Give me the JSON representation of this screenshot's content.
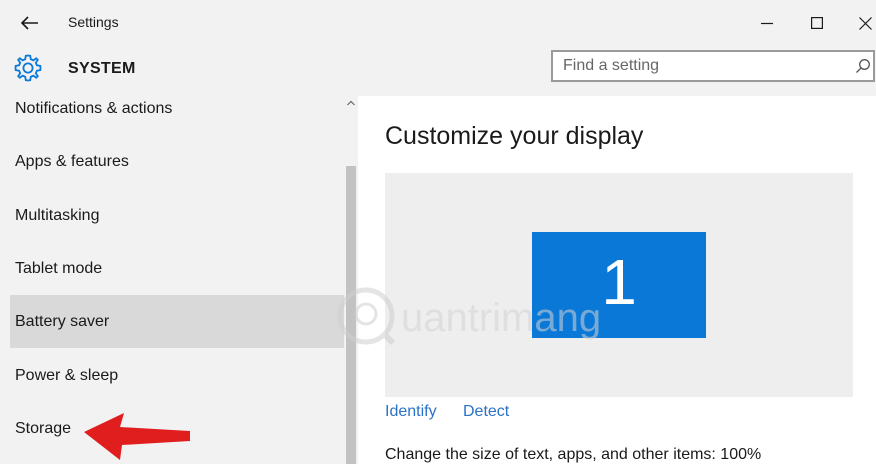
{
  "window": {
    "title": "Settings"
  },
  "header": {
    "section_title": "SYSTEM",
    "search": {
      "placeholder": "Find a setting",
      "value": ""
    }
  },
  "sidebar": {
    "items": [
      {
        "label": "Notifications & actions",
        "selected": false
      },
      {
        "label": "Apps & features",
        "selected": false
      },
      {
        "label": "Multitasking",
        "selected": false
      },
      {
        "label": "Tablet mode",
        "selected": false
      },
      {
        "label": "Battery saver",
        "selected": true
      },
      {
        "label": "Power & sleep",
        "selected": false
      },
      {
        "label": "Storage",
        "selected": false
      }
    ]
  },
  "main": {
    "title": "Customize your display",
    "monitor_number": "1",
    "identify_label": "Identify",
    "detect_label": "Detect",
    "scale_text": "Change the size of text, apps, and other items: 100%"
  },
  "watermark": {
    "text": "uantrimang"
  },
  "colors": {
    "accent": "#0a78d7",
    "link": "#2a72c8",
    "arrow": "#e01e1e",
    "selected_bg": "#d9d9d9"
  },
  "icons": {
    "back": "arrow-left-icon",
    "minimize": "minimize-icon",
    "maximize": "maximize-icon",
    "close": "close-icon",
    "system": "gear-icon",
    "search": "search-icon",
    "scroll_up": "chevron-up-icon"
  }
}
